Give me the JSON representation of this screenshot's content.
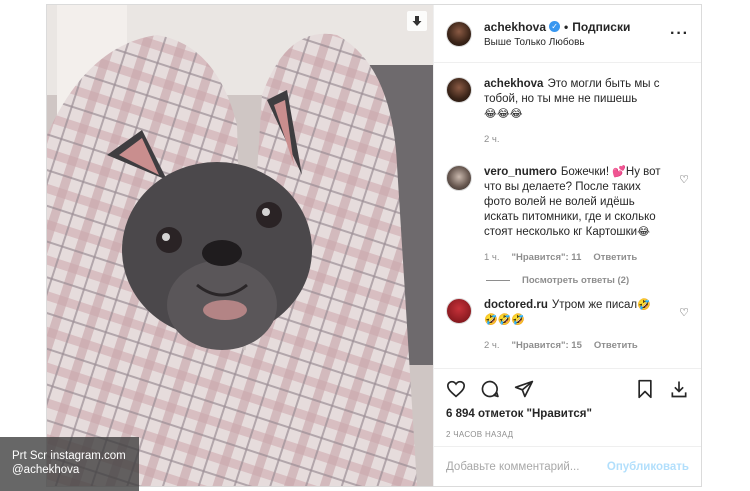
{
  "header": {
    "username": "achekhova",
    "separator": "•",
    "follow_label": "Подписки",
    "location": "Выше Только Любовь",
    "more_label": "···"
  },
  "caption": {
    "username": "achekhova",
    "text": "Это могли быть мы с тобой, но ты мне не пишешь",
    "emoji": "😂😂😂",
    "time": "2 ч."
  },
  "comments": [
    {
      "username": "vero_numero",
      "text_before": "Божечки! ",
      "text_emoji1": "💕",
      "text_mid": "Ну вот что вы делаете? После таких фото волей не волей идёшь искать питомники, где и сколько стоят несколько кг Картошки",
      "text_emoji2": "😂",
      "time": "1 ч.",
      "likes": "\"Нравится\": 11",
      "reply": "Ответить",
      "replies": "Посмотреть ответы (2)"
    },
    {
      "username": "doctored.ru",
      "text_before": "Утром же писал",
      "text_emoji1": "🤣",
      "text_emoji2": "🤣🤣🤣",
      "time": "2 ч.",
      "likes": "\"Нравится\": 15",
      "reply": "Ответить"
    }
  ],
  "likes_text": "6 894 отметок \"Нравится\"",
  "time_ago": "2 ЧАСОВ НАЗАД",
  "add_comment": {
    "placeholder": "Добавьте комментарий...",
    "publish": "Опубликовать"
  },
  "watermark": {
    "line1": "Prt Scr instagram.com",
    "line2": "@achekhova"
  },
  "icons": [
    "heart-icon",
    "comment-icon",
    "share-icon",
    "bookmark-icon",
    "download-icon",
    "verified-icon",
    "more-icon"
  ]
}
